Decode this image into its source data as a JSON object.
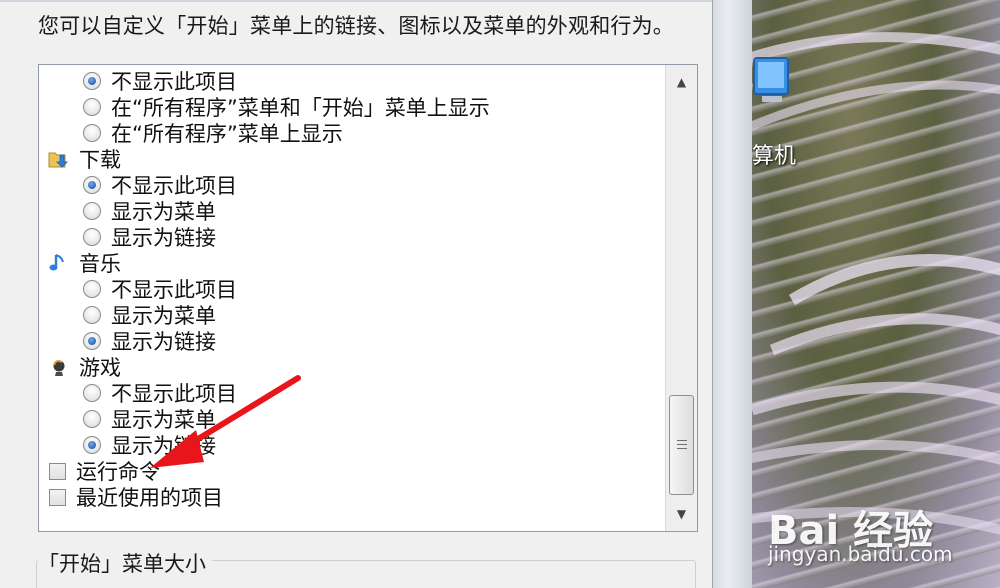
{
  "dialog": {
    "description": "您可以自定义「开始」菜单上的链接、图标以及菜单的外观和行为。",
    "group_title": "「开始」菜单大小"
  },
  "list": {
    "rows": [
      {
        "kind": "radio",
        "label": "不显示此项目",
        "checked": true
      },
      {
        "kind": "radio",
        "label": "在“所有程序”菜单和「开始」菜单上显示",
        "checked": false
      },
      {
        "kind": "radio",
        "label": "在“所有程序”菜单上显示",
        "checked": false
      },
      {
        "kind": "header",
        "label": "下载",
        "icon": "download-folder-icon"
      },
      {
        "kind": "radio",
        "label": "不显示此项目",
        "checked": true
      },
      {
        "kind": "radio",
        "label": "显示为菜单",
        "checked": false
      },
      {
        "kind": "radio",
        "label": "显示为链接",
        "checked": false
      },
      {
        "kind": "header",
        "label": "音乐",
        "icon": "music-note-icon"
      },
      {
        "kind": "radio",
        "label": "不显示此项目",
        "checked": false
      },
      {
        "kind": "radio",
        "label": "显示为菜单",
        "checked": false
      },
      {
        "kind": "radio",
        "label": "显示为链接",
        "checked": true
      },
      {
        "kind": "header",
        "label": "游戏",
        "icon": "games-icon"
      },
      {
        "kind": "radio",
        "label": "不显示此项目",
        "checked": false
      },
      {
        "kind": "radio",
        "label": "显示为菜单",
        "checked": false
      },
      {
        "kind": "radio",
        "label": "显示为链接",
        "checked": true
      },
      {
        "kind": "checkbox",
        "label": "运行命令",
        "checked": false
      },
      {
        "kind": "checkbox",
        "label": "最近使用的项目",
        "checked": false
      }
    ]
  },
  "desktop": {
    "icon_label": "算机",
    "watermark_brand": "Bai 经验",
    "watermark_url": "jingyan.baidu.com"
  },
  "colors": {
    "annotation_arrow": "#e8161b",
    "radio_selected": "#2d66b8"
  }
}
